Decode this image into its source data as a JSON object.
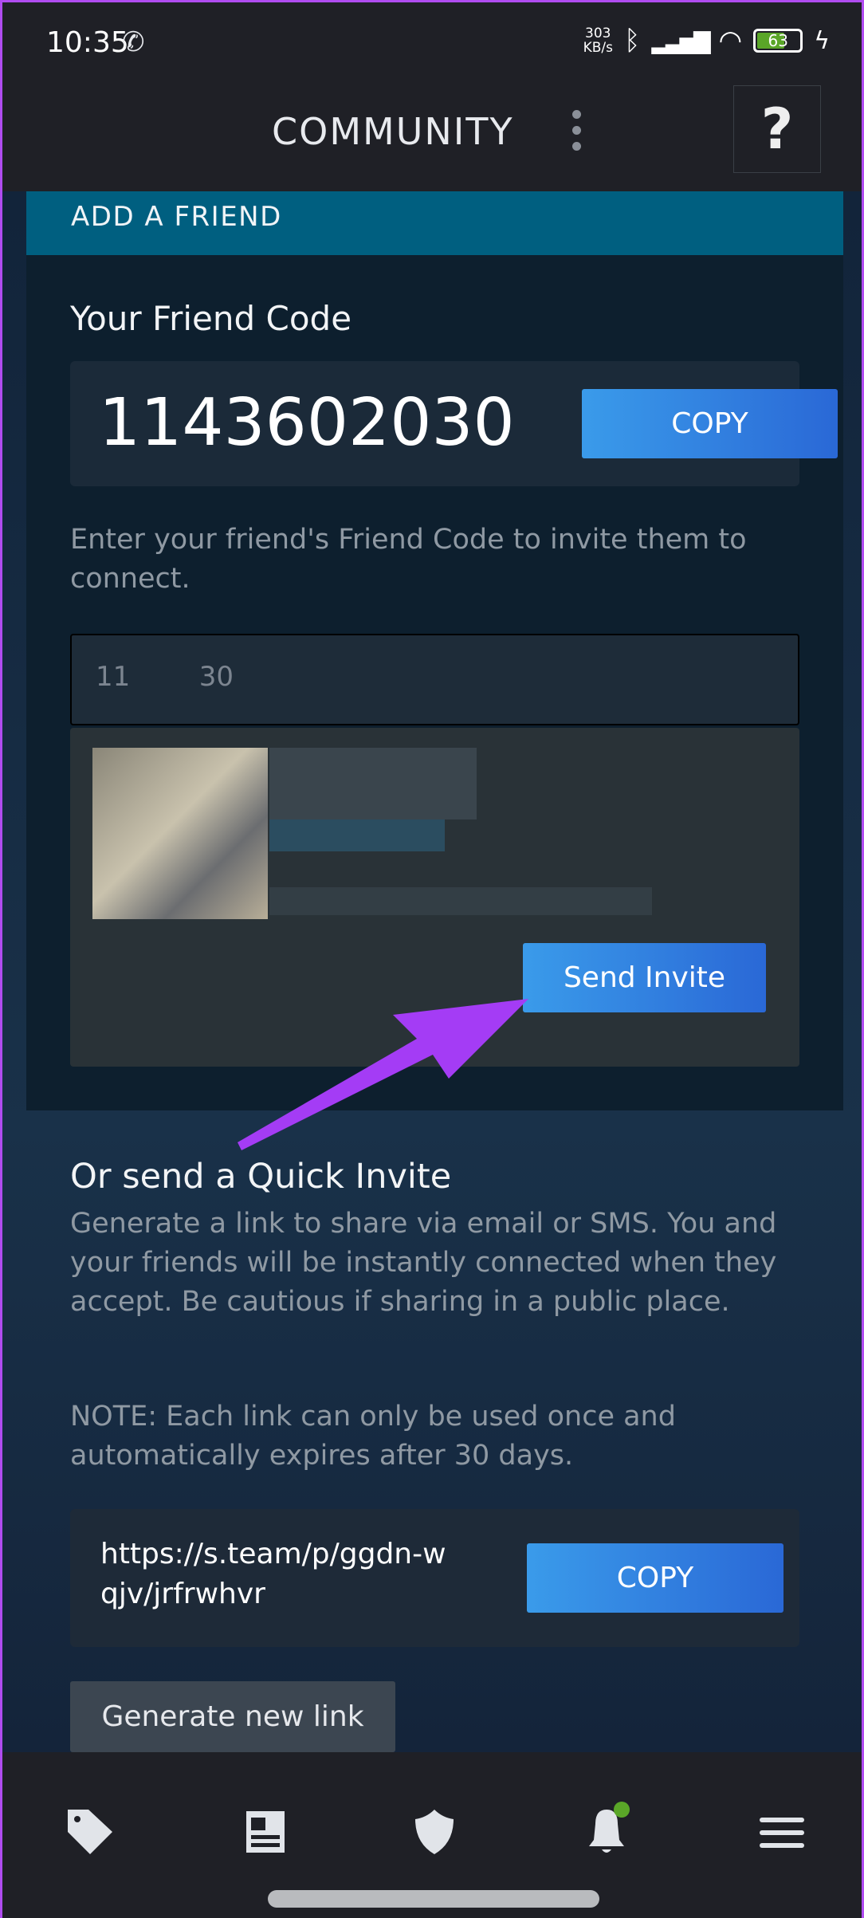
{
  "status_bar": {
    "time": "10:35",
    "speed_value": "303",
    "speed_unit": "KB/s",
    "battery": "63"
  },
  "header": {
    "title": "COMMUNITY",
    "help_label": "?"
  },
  "add_friend": {
    "banner": "ADD A FRIEND",
    "friend_code_label": "Your Friend Code",
    "friend_code": "1143602030",
    "copy_label": "COPY",
    "instruction": "Enter your friend's Friend Code to invite them to connect.",
    "input_value": "11        30",
    "send_invite_label": "Send Invite"
  },
  "quick_invite": {
    "title": "Or send a Quick Invite",
    "description": "Generate a link to share via email or SMS. You and your friends will be instantly connected when they accept. Be cautious if sharing in a public place.",
    "note": "NOTE: Each link can only be used once and automatically expires after 30 days.",
    "link": "https://s.team/p/ggdn-wqjv/jrfrwhvr",
    "copy_label": "COPY",
    "generate_label": "Generate new link"
  },
  "nav": {
    "items": [
      {
        "icon": "tag-icon"
      },
      {
        "icon": "news-icon"
      },
      {
        "icon": "shield-icon"
      },
      {
        "icon": "bell-icon",
        "badge_color": "#5aa628"
      },
      {
        "icon": "menu-icon"
      }
    ]
  },
  "colors": {
    "accent": "#2a80e0",
    "banner": "#005f80",
    "annotation_arrow": "#a43cf5"
  }
}
